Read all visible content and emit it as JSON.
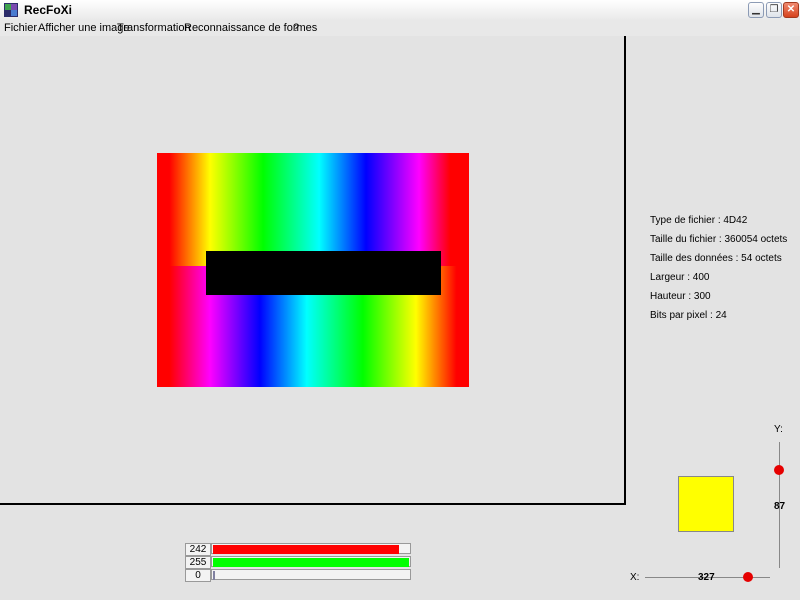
{
  "window": {
    "title": "RecFoXi"
  },
  "menu": [
    "Fichier",
    "Afficher une image",
    "Transformation",
    "Reconnaissance de formes",
    "?"
  ],
  "file_info": [
    "Type de fichier : 4D42",
    "Taille du fichier : 360054 octets",
    "Taille des données : 54 octets",
    "Largeur : 400",
    "Hauteur : 300",
    "Bits par pixel : 24"
  ],
  "rgb": [
    {
      "value": "242",
      "level": 242,
      "color": "#ff0000"
    },
    {
      "value": "255",
      "level": 255,
      "color": "#00ff00"
    },
    {
      "value": "0",
      "level": 0,
      "color": "#0000ff"
    }
  ],
  "swatch_color": "#ffff00",
  "cursor": {
    "x_label": "X:",
    "y_label": "Y:",
    "x": "327",
    "y": "87",
    "x_level": 0.82,
    "y_level": 0.78
  },
  "icons": [
    "app-icon",
    "minimize-icon",
    "restore-icon",
    "close-icon"
  ]
}
